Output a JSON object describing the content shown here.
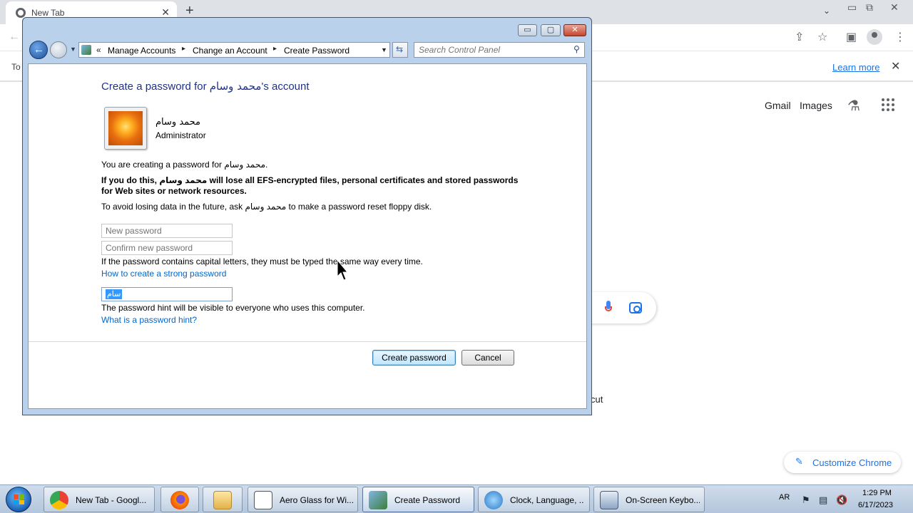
{
  "chrome": {
    "tab_title": "New Tab",
    "tab_close": "✕",
    "new_tab": "+",
    "infobar_text": "To",
    "learn_more": "Learn more",
    "infobar_close": "✕",
    "gmail": "Gmail",
    "images": "Images",
    "shortcut_text": "cut",
    "customize": "Customize Chrome",
    "icons": [
      "chrome-icon",
      "back-arrow-icon",
      "share-icon",
      "star-icon",
      "sidepanel-icon",
      "profile-icon",
      "menu-icon",
      "labs-icon",
      "apps-icon",
      "mic-icon",
      "lens-icon",
      "pencil-icon"
    ]
  },
  "dialog": {
    "window_buttons": {
      "minimize": "▭",
      "maximize": "▢",
      "close": "✕"
    },
    "address": {
      "chevron": "«",
      "crumbs": [
        "Manage Accounts",
        "Change an Account",
        "Create Password"
      ],
      "separator": "▸"
    },
    "search_placeholder": "Search Control Panel",
    "title_prefix": "Create a password for ",
    "title_name": "محمد وسام",
    "title_suffix": "'s account",
    "user": {
      "name": "محمد وسام",
      "role": "Administrator"
    },
    "creating_text": "You are creating a password for محمد وسام.",
    "warning_text": "If you do this, محمد وسام will lose all EFS-encrypted files, personal certificates and stored passwords for Web sites or network resources.",
    "avoid_text": "To avoid losing data in the future, ask محمد وسام to make a password reset floppy disk.",
    "new_password_placeholder": "New password",
    "confirm_password_placeholder": "Confirm new password",
    "caps_text": "If the password contains capital letters, they must be typed the same way every time.",
    "strong_link": "How to create a strong password",
    "hint_value": "سام",
    "hint_visible_text": "The password hint will be visible to everyone who uses this computer.",
    "hint_link": "What is a password hint?",
    "create_button": "Create password",
    "cancel_button": "Cancel"
  },
  "taskbar": {
    "items": [
      {
        "label": "New Tab - Googl..."
      },
      {
        "label": ""
      },
      {
        "label": ""
      },
      {
        "label": "Aero Glass for Wi..."
      },
      {
        "label": "Create Password"
      },
      {
        "label": "Clock, Language, ..."
      },
      {
        "label": "On-Screen Keybo..."
      }
    ],
    "lang": "AR",
    "time": "1:29 PM",
    "date": "6/17/2023"
  }
}
